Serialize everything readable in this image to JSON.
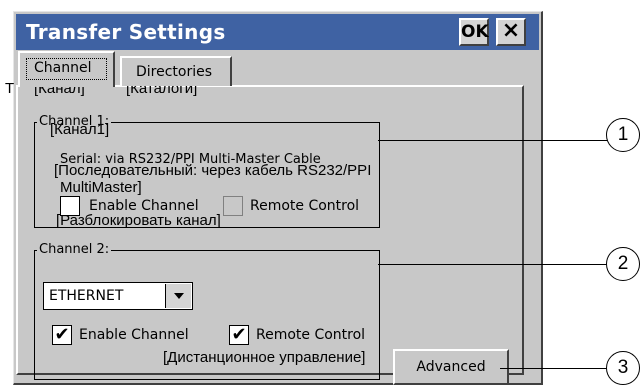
{
  "window": {
    "title": "Transfer Settings",
    "ok_label": "OK",
    "close_label": "×"
  },
  "tabs": [
    {
      "label": "Channel",
      "translation": "[Канал]"
    },
    {
      "label": "Directories",
      "translation": "[Каталоги]"
    }
  ],
  "prefix_text": "T",
  "channel1": {
    "group_label": "Channel 1:",
    "group_translation": "[Канал1]",
    "description": "Serial: via RS232/PPI Multi-Master Cable",
    "description_translation_line1": "[Последовательный: через кабель RS232/PPI",
    "description_translation_line2": "MultiMaster]",
    "enable_label": "Enable Channel",
    "enable_checked": false,
    "enable_translation": "[Разблокировать канал]",
    "remote_label": "Remote Control",
    "remote_checked": false,
    "remote_disabled": true
  },
  "channel2": {
    "group_label": "Channel 2:",
    "select_value": "ETHERNET",
    "enable_label": "Enable Channel",
    "enable_checked": true,
    "remote_label": "Remote Control",
    "remote_checked": true,
    "remote_translation": "[Дистанционное управление]"
  },
  "advanced_label": "Advanced",
  "check_glyph": "✔",
  "callouts": [
    "1",
    "2",
    "3"
  ]
}
